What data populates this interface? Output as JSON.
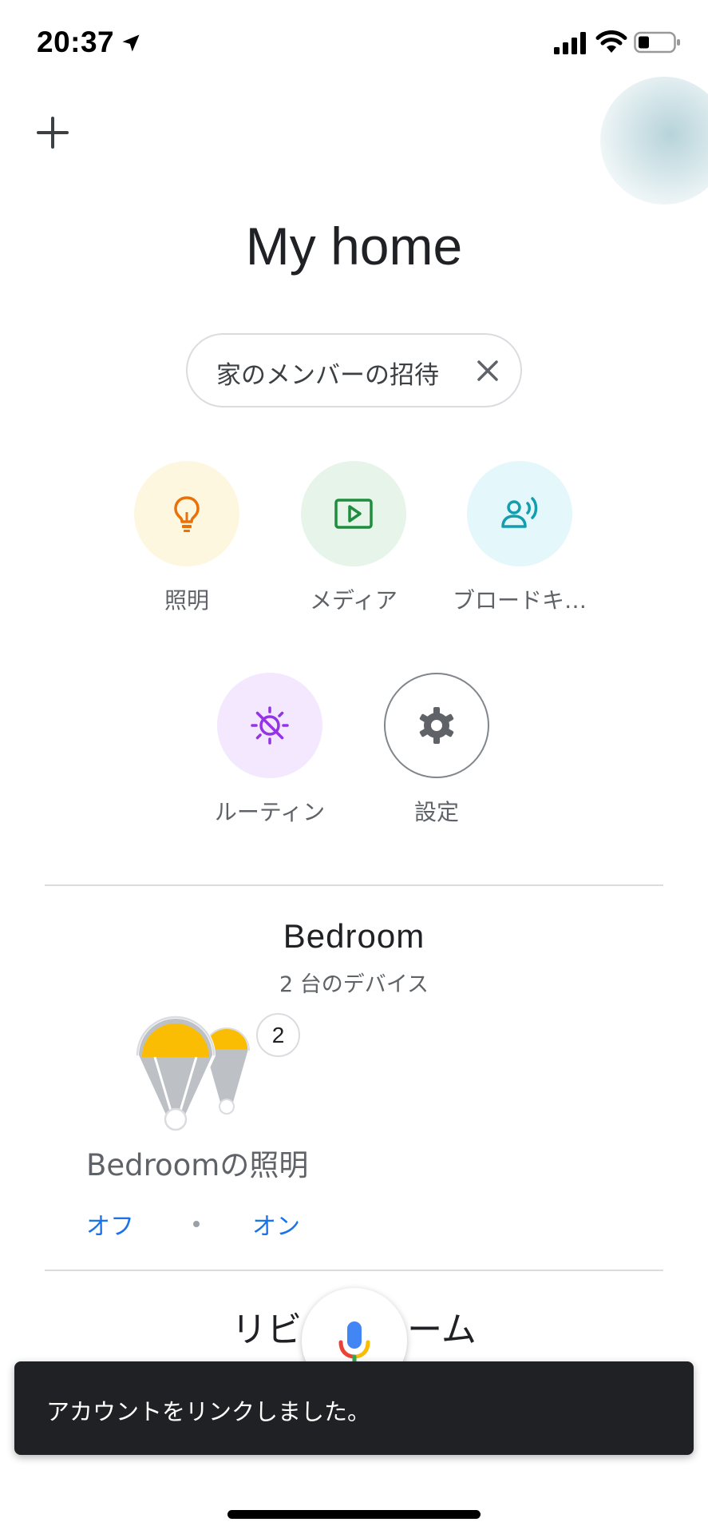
{
  "status_bar": {
    "time": "20:37"
  },
  "header": {
    "title": "My home"
  },
  "invite_chip": {
    "label": "家のメンバーの招待"
  },
  "shortcuts": [
    {
      "label": "照明",
      "icon": "lightbulb-icon",
      "bg": "#fef7e0",
      "color": "#e8710a"
    },
    {
      "label": "メディア",
      "icon": "media-play-icon",
      "bg": "#e6f4ea",
      "color": "#1e8e3e"
    },
    {
      "label": "ブロードキ…",
      "icon": "broadcast-icon",
      "bg": "#e4f7fb",
      "color": "#129eaf"
    },
    {
      "label": "ルーティン",
      "icon": "routine-icon",
      "bg": "#f3e8fd",
      "color": "#9334e6"
    },
    {
      "label": "設定",
      "icon": "gear-icon",
      "bg": "#ffffff",
      "color": "#5f6368"
    }
  ],
  "rooms": [
    {
      "name": "Bedroom",
      "device_count_text": "2 台のデバイス",
      "group": {
        "name": "Bedroomの照明",
        "count": "2",
        "off_label": "オフ",
        "on_label": "オン"
      }
    },
    {
      "name": "リビングルーム"
    }
  ],
  "snackbar": {
    "message": "アカウントをリンクしました。"
  },
  "colors": {
    "accent": "#1a73e8",
    "bulb_yellow": "#fbbc04"
  }
}
